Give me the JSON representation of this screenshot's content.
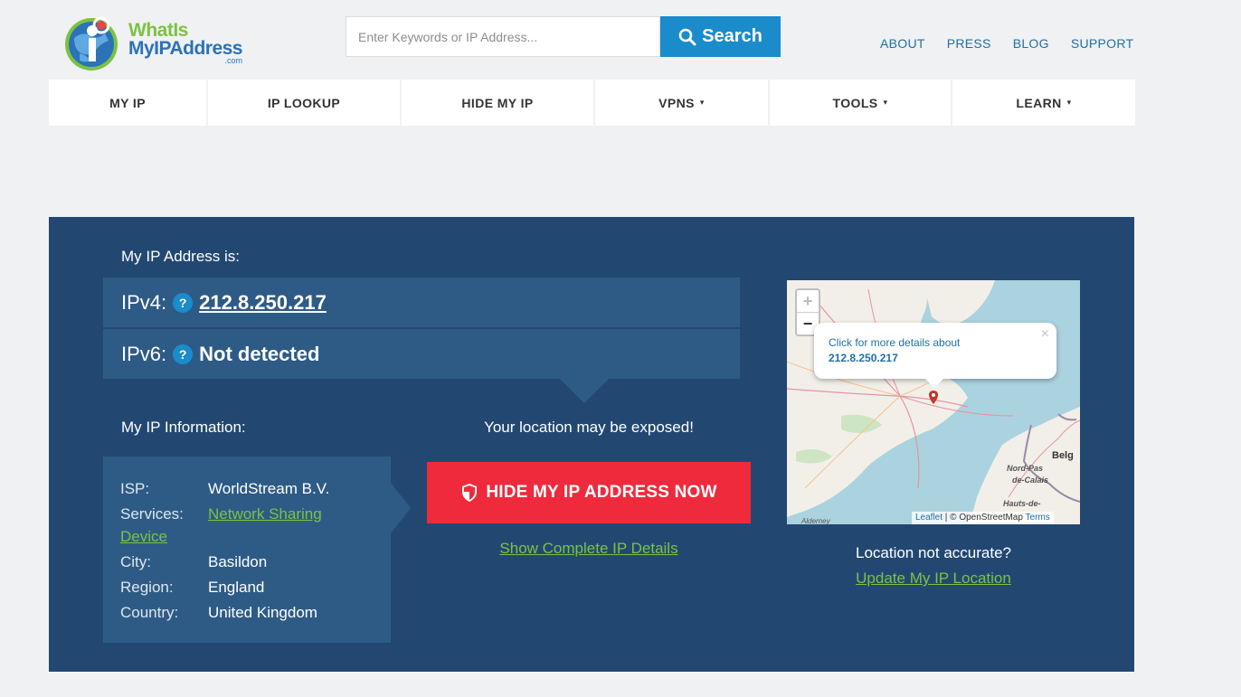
{
  "header": {
    "logo": {
      "line1": "WhatIs",
      "line2": "MyIPAddress",
      "suffix": ".com"
    },
    "search": {
      "placeholder": "Enter Keywords or IP Address...",
      "button_label": "Search"
    },
    "top_links": [
      "ABOUT",
      "PRESS",
      "BLOG",
      "SUPPORT"
    ]
  },
  "nav": {
    "items": [
      {
        "label": "MY IP",
        "dropdown": false
      },
      {
        "label": "IP LOOKUP",
        "dropdown": false
      },
      {
        "label": "HIDE MY IP",
        "dropdown": false
      },
      {
        "label": "VPNS",
        "dropdown": true
      },
      {
        "label": "TOOLS",
        "dropdown": true
      },
      {
        "label": "LEARN",
        "dropdown": true
      }
    ],
    "caret": "▾"
  },
  "main": {
    "ip_heading": "My IP Address is:",
    "ipv4_label": "IPv4:",
    "ipv4_value": "212.8.250.217",
    "ipv6_label": "IPv6:",
    "ipv6_value": "Not detected",
    "help_glyph": "?",
    "info_heading": "My IP Information:",
    "info": {
      "isp_key": "ISP:",
      "isp_val": "WorldStream B.V.",
      "services_key": "Services:",
      "services_val_1": "Network Sharing",
      "services_val_2": "Device",
      "city_key": "City:",
      "city_val": "Basildon",
      "region_key": "Region:",
      "region_val": "England",
      "country_key": "Country:",
      "country_val": "United Kingdom"
    },
    "exposed_text": "Your location may be exposed!",
    "hide_button": "HIDE MY IP ADDRESS NOW",
    "show_details": "Show Complete IP Details"
  },
  "map": {
    "zoom_in": "+",
    "zoom_out": "−",
    "popup_text": "Click for more details about",
    "popup_ip": "212.8.250.217",
    "popup_close": "×",
    "labels": {
      "belg": "Belg",
      "nord": "Nord-Pas",
      "calais": "de-Calais",
      "hauts": "Hauts-de-",
      "alderney": "Alderney"
    },
    "attribution_leaflet": "Leaflet",
    "attribution_sep": " | © OpenStreetMap ",
    "attribution_terms": "Terms",
    "location_question": "Location not accurate?",
    "update_link": "Update My IP Location"
  },
  "colors": {
    "panel_bg": "#224872",
    "panel_row": "#2e5b86",
    "accent_blue": "#1a8bcb",
    "cta_red": "#ef2a3c",
    "link_green": "#7cc242",
    "page_bg": "#f0f1f3"
  }
}
